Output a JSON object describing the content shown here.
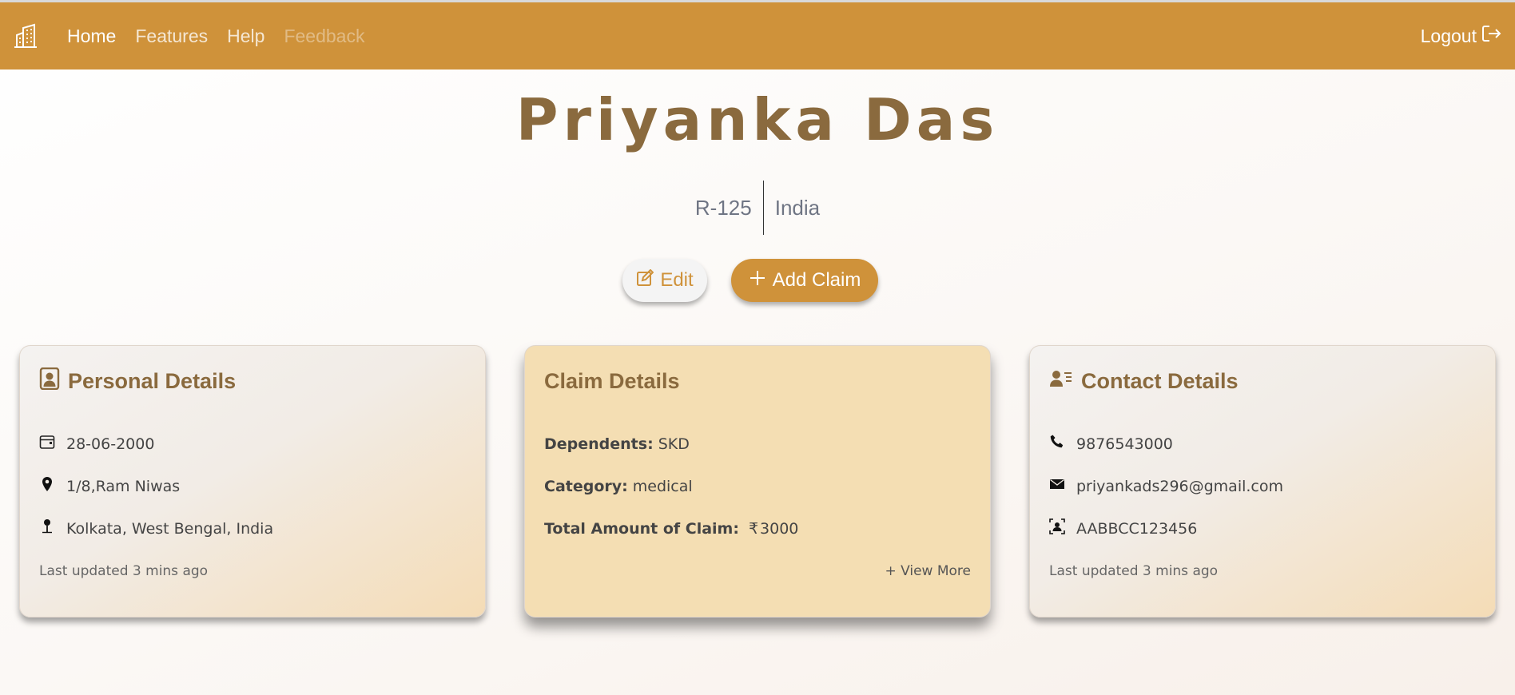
{
  "nav": {
    "brand_icon": "building-icon",
    "links": [
      "Home",
      "Features",
      "Help",
      "Feedback"
    ],
    "logout_label": "Logout",
    "logout_icon": "logout-icon"
  },
  "profile": {
    "name": "Priyanka Das",
    "id": "R-125",
    "country": "India"
  },
  "actions": {
    "edit_label": "Edit",
    "add_claim_label": "Add Claim"
  },
  "personal": {
    "title": "Personal Details",
    "dob": "28-06-2000",
    "address": "1/8,Ram Niwas",
    "location": "Kolkata, West Bengal, India",
    "updated": "Last updated 3 mins ago"
  },
  "claim": {
    "title": "Claim Details",
    "dependents_label": "Dependents:",
    "dependents_value": "SKD",
    "category_label": "Category:",
    "category_value": "medical",
    "total_label": "Total Amount of Claim:",
    "currency": "₹",
    "total_value": "3000",
    "view_more": "+ View More"
  },
  "contact": {
    "title": "Contact Details",
    "phone": "9876543000",
    "email": "priyankads296@gmail.com",
    "pan": "AABBCC123456",
    "updated": "Last updated 3 mins ago"
  },
  "colors": {
    "primary": "#cf923a",
    "title_brown": "#8a6a3e",
    "claim_card": "#f4deb3"
  }
}
